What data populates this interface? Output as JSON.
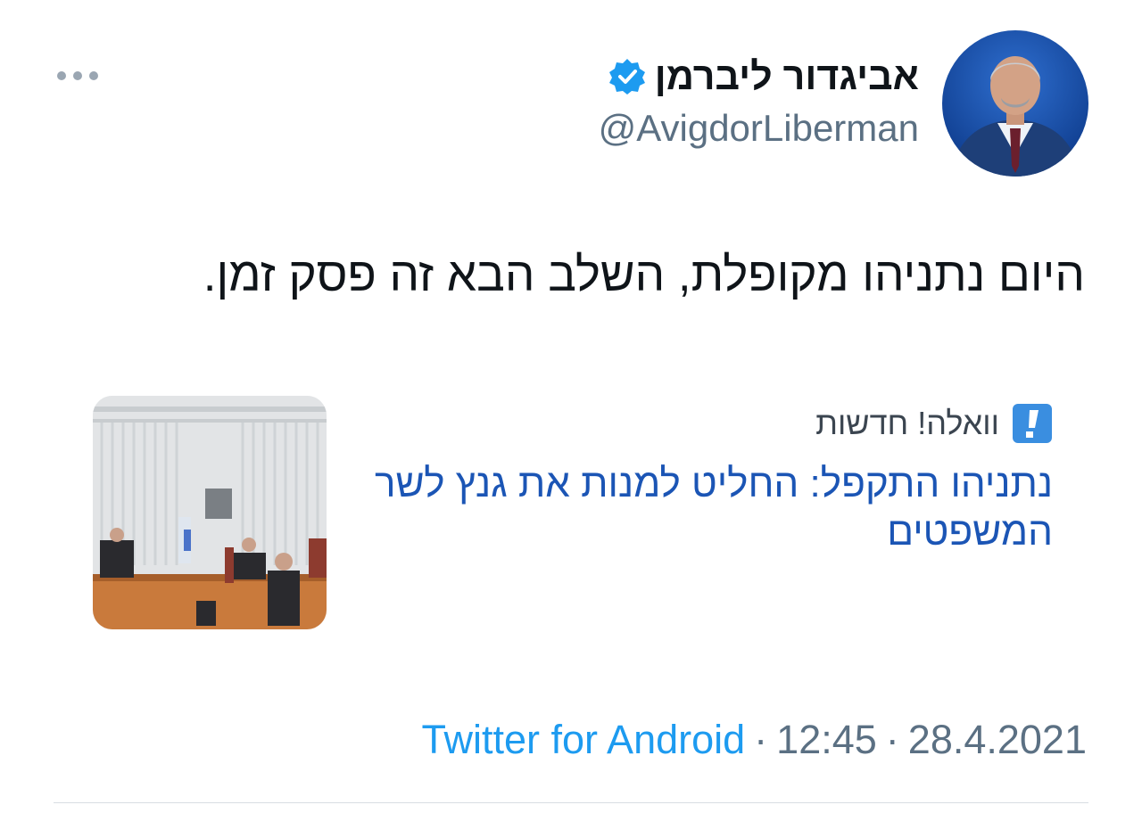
{
  "tweet": {
    "author": {
      "display_name": "אביגדור ליברמן",
      "handle": "@AvigdorLiberman",
      "verified": true,
      "verified_icon": "verified-badge-icon"
    },
    "text": "היום נתניהו מקופלת, השלב הבא זה פסק זמן.",
    "card": {
      "source_name": "וואלה! חדשות",
      "source_icon": "walla-logo-icon",
      "title": "נתניהו התקפל: החליט למנות את גנץ לשר המשפטים"
    },
    "meta": {
      "app": "Twitter for Android",
      "separator": "·",
      "time": "12:45",
      "date": "28.4.2021"
    },
    "more_icon": "more-options-icon"
  },
  "colors": {
    "accent": "#1d9bf0",
    "card_title": "#1b55b5",
    "secondary_text": "#5b7083",
    "primary_text": "#0f1419"
  }
}
